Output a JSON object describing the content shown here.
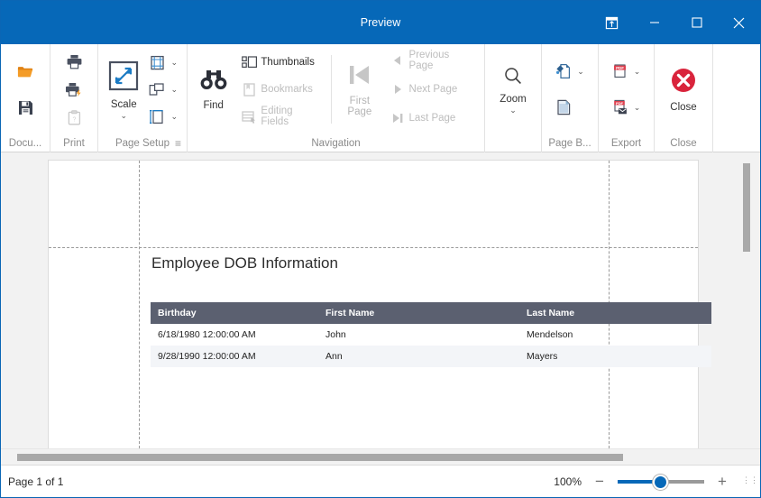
{
  "window": {
    "title": "Preview",
    "accent_color": "#0668b8",
    "buttons": {
      "ribbon_display": "ribbon-display-options",
      "minimize": "Minimize",
      "maximize": "Maximize",
      "close": "Close"
    }
  },
  "ribbon": {
    "groups": [
      {
        "label": "Docu...",
        "items": [
          {
            "name": "open-document",
            "label": "",
            "icon": "open-folder-icon",
            "enabled": true
          },
          {
            "name": "save-document",
            "label": "",
            "icon": "save-floppy-icon",
            "enabled": true
          }
        ]
      },
      {
        "label": "Print",
        "items": [
          {
            "name": "print",
            "label": "",
            "icon": "printer-icon",
            "enabled": true
          },
          {
            "name": "quick-print",
            "label": "",
            "icon": "quick-print-icon",
            "enabled": true
          },
          {
            "name": "print-options",
            "label": "",
            "icon": "clipboard-icon",
            "enabled": false
          }
        ]
      },
      {
        "label": "Page Setup",
        "dialog_launcher": "≡",
        "items": [
          {
            "name": "scale",
            "label": "Scale",
            "icon": "scale-icon",
            "enabled": true,
            "caret": "⌄"
          },
          {
            "name": "margins",
            "label": "",
            "icon": "margins-icon",
            "enabled": true,
            "caret": "⌄"
          },
          {
            "name": "orientation",
            "label": "",
            "icon": "orientation-icon",
            "enabled": true,
            "caret": "⌄"
          },
          {
            "name": "paper-size",
            "label": "",
            "icon": "paper-size-icon",
            "enabled": true,
            "caret": "⌄"
          }
        ]
      },
      {
        "label": "Navigation",
        "items": [
          {
            "name": "find",
            "label": "Find",
            "icon": "binoculars-icon",
            "enabled": true
          },
          {
            "name": "thumbnails",
            "label": "Thumbnails",
            "icon": "thumbnails-icon",
            "enabled": true
          },
          {
            "name": "bookmarks",
            "label": "Bookmarks",
            "icon": "bookmark-icon",
            "enabled": false
          },
          {
            "name": "editing-fields",
            "label": "Editing Fields",
            "icon": "editing-fields-icon",
            "enabled": false
          },
          {
            "name": "first-page",
            "label": "First Page",
            "icon": "first-page-icon",
            "enabled": false
          },
          {
            "name": "previous-page",
            "label": "Previous Page",
            "icon": "previous-page-icon",
            "enabled": false
          },
          {
            "name": "next-page",
            "label": "Next Page",
            "icon": "next-page-icon",
            "enabled": false
          },
          {
            "name": "last-page",
            "label": "Last Page",
            "icon": "last-page-icon",
            "enabled": false
          }
        ]
      },
      {
        "label": "",
        "items": [
          {
            "name": "zoom",
            "label": "Zoom",
            "icon": "magnifier-icon",
            "enabled": true,
            "caret": "⌄"
          }
        ]
      },
      {
        "label": "Page B...",
        "items": [
          {
            "name": "page-color",
            "label": "",
            "icon": "page-color-icon",
            "enabled": true,
            "caret": "⌄"
          },
          {
            "name": "watermark",
            "label": "",
            "icon": "watermark-icon",
            "enabled": true
          }
        ]
      },
      {
        "label": "Export",
        "items": [
          {
            "name": "export-to",
            "label": "",
            "icon": "pdf-export-icon",
            "enabled": true,
            "caret": "⌄"
          },
          {
            "name": "send-via-email",
            "label": "",
            "icon": "pdf-email-icon",
            "enabled": true,
            "caret": "⌄"
          }
        ]
      },
      {
        "label": "Close",
        "items": [
          {
            "name": "close-preview",
            "label": "Close",
            "icon": "close-circle-icon",
            "enabled": true
          }
        ]
      }
    ],
    "labels": {
      "document": "Docu...",
      "print": "Print",
      "page_setup": "Page Setup",
      "page_setup_launcher": "≡",
      "navigation": "Navigation",
      "page_background": "Page B...",
      "export": "Export",
      "close": "Close"
    },
    "buttons": {
      "scale": "Scale",
      "find": "Find",
      "thumbnails": "Thumbnails",
      "bookmarks": "Bookmarks",
      "editing_fields": "Editing Fields",
      "first_page": "First\nPage",
      "first_page_l1": "First",
      "first_page_l2": "Page",
      "previous_page": "Previous Page",
      "next_page": "Next  Page",
      "last_page": "Last  Page",
      "zoom": "Zoom",
      "close": "Close"
    }
  },
  "document": {
    "report_title": "Employee DOB Information",
    "table": {
      "columns": [
        "Birthday",
        "First Name",
        "Last Name"
      ],
      "header_bg": "#5b6070",
      "rows": [
        [
          "6/18/1980 12:00:00 AM",
          "John",
          "Mendelson"
        ],
        [
          "9/28/1990 12:00:00 AM",
          "Ann",
          "Mayers"
        ]
      ]
    }
  },
  "statusbar": {
    "page_info": "Page 1 of 1",
    "zoom_percent": "100%",
    "zoom_out": "−",
    "zoom_in": "+"
  }
}
